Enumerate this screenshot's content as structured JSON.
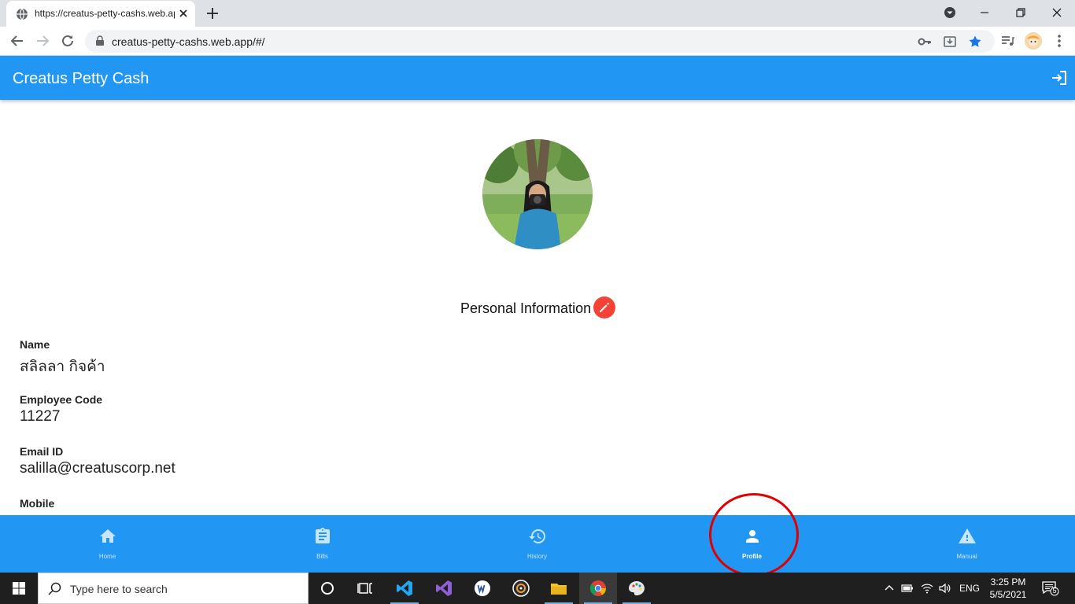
{
  "browser": {
    "tab_title": "https://creatus-petty-cashs.web.app/#/",
    "url": "creatus-petty-cashs.web.app/#/"
  },
  "app": {
    "title": "Creatus Petty Cash",
    "logout_icon": "logout-icon",
    "accent_color": "#2196f3",
    "edit_color": "#f44336"
  },
  "profile": {
    "section_title": "Personal Information",
    "fields": [
      {
        "label": "Name",
        "value": "สลิลลา  กิจค้า"
      },
      {
        "label": "Employee Code",
        "value": "11227"
      },
      {
        "label": "Email ID",
        "value": "salilla@creatuscorp.net"
      },
      {
        "label": "Mobile",
        "value": ""
      }
    ]
  },
  "bottom_nav": {
    "items": [
      {
        "label": "Home",
        "icon": "home-icon"
      },
      {
        "label": "Bills",
        "icon": "clipboard-icon"
      },
      {
        "label": "History",
        "icon": "history-icon"
      },
      {
        "label": "Profile",
        "icon": "person-icon",
        "active": true
      },
      {
        "label": "Manual",
        "icon": "warning-icon"
      }
    ]
  },
  "taskbar": {
    "search_placeholder": "Type here to search",
    "language": "ENG",
    "time": "3:25 PM",
    "date": "5/5/2021",
    "notification_count": "5"
  }
}
